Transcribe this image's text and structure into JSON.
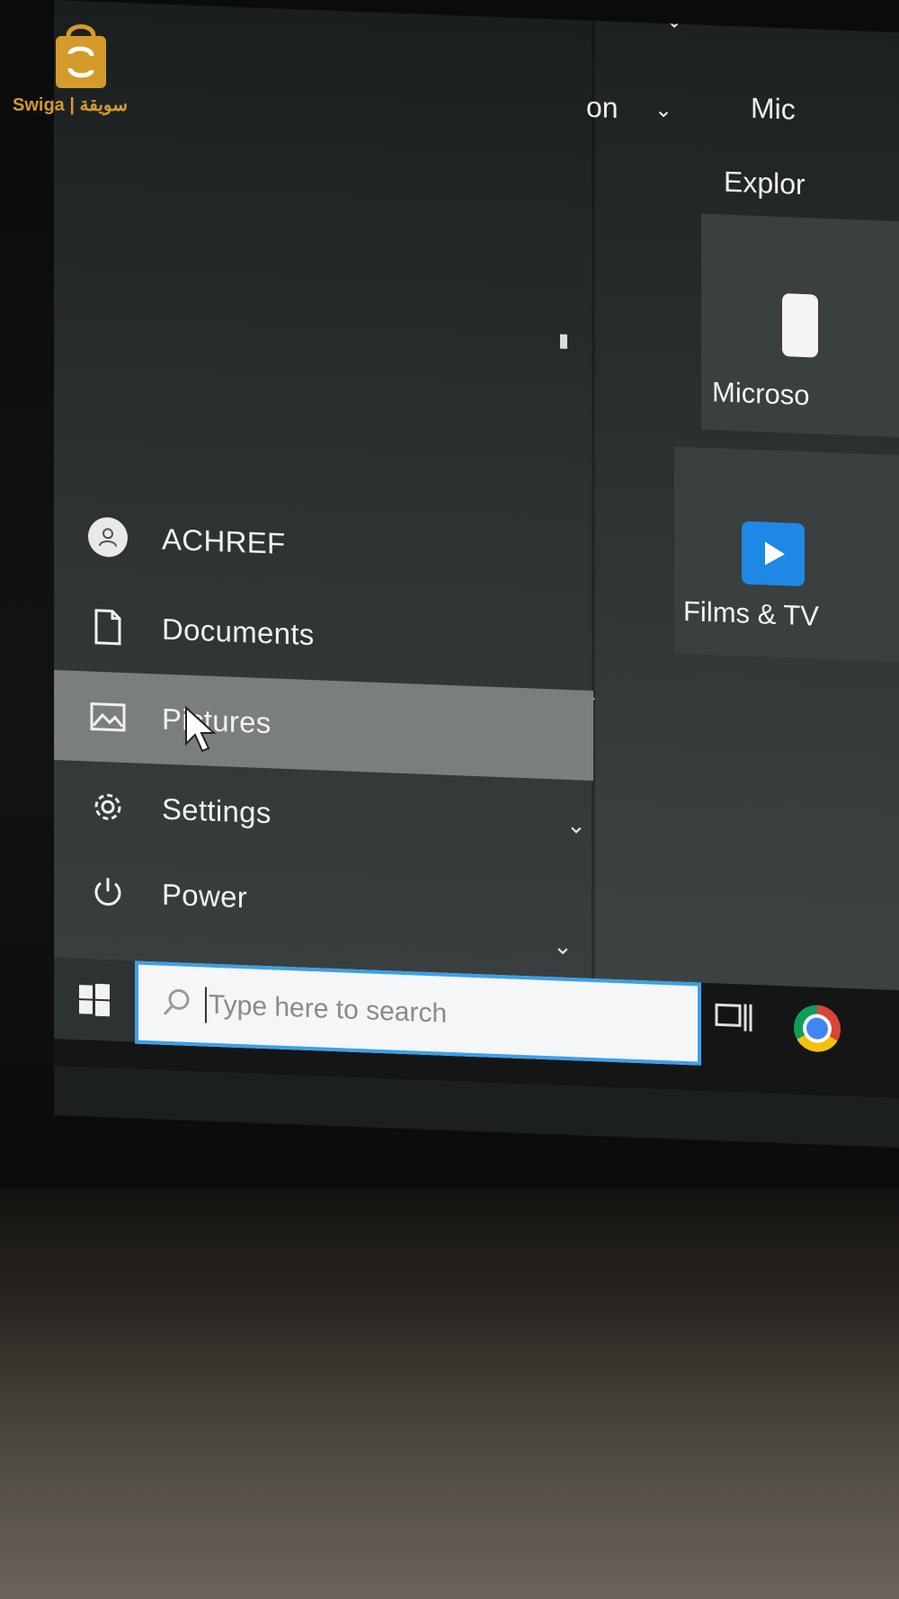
{
  "watermark": {
    "text": "Swiga | سويقة"
  },
  "top_right": {
    "partial_text_1": "on",
    "partial_text_2": "Mic",
    "partial_text_3": "Explor"
  },
  "tiles": [
    {
      "label": "Microso"
    },
    {
      "label": "Films & TV"
    }
  ],
  "start_menu": {
    "user": {
      "label": "ACHREF",
      "icon": "user-avatar-icon"
    },
    "items": [
      {
        "label": "Documents",
        "icon": "document-icon"
      },
      {
        "label": "Pictures",
        "icon": "pictures-icon"
      },
      {
        "label": "Settings",
        "icon": "gear-icon"
      },
      {
        "label": "Power",
        "icon": "power-icon"
      }
    ],
    "hover_item": "Pictures"
  },
  "taskbar": {
    "search": {
      "placeholder": "Type here to search"
    },
    "pinned": [
      {
        "icon": "task-view-icon"
      },
      {
        "icon": "chrome-icon"
      }
    ]
  },
  "colors": {
    "search_border": "#3aa0e8",
    "hover_bg": "#7a7f7e",
    "watermark": "#d49a2a"
  }
}
